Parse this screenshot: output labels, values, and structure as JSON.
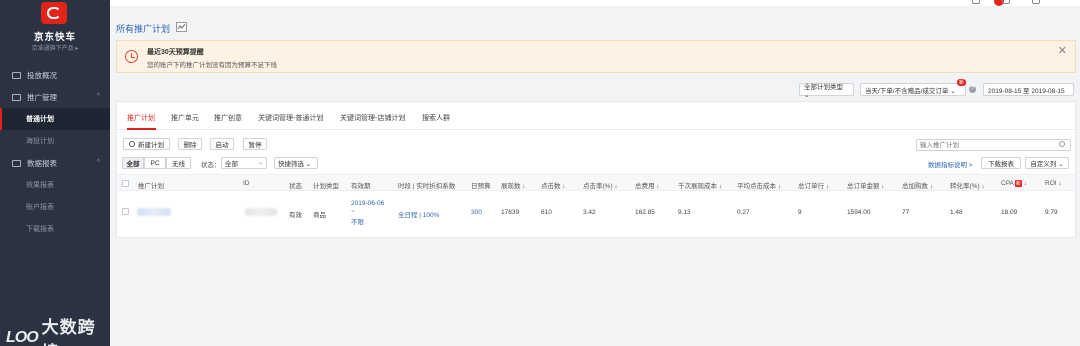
{
  "sidebar": {
    "brand": "京东快车",
    "brand_sub": "京准通旗下产品 ▸",
    "items": [
      {
        "label": "投放概况"
      },
      {
        "label": "推广管理"
      },
      {
        "label": "数据报表"
      }
    ],
    "sub_promo": [
      {
        "label": "普通计划"
      },
      {
        "label": "海投计划"
      }
    ],
    "sub_report": [
      {
        "label": "效果报表"
      },
      {
        "label": "账户报表"
      },
      {
        "label": "下载报表"
      }
    ]
  },
  "watermark": {
    "logo": "LOO",
    "text": "大数跨境"
  },
  "header": {
    "title": "所有推广计划"
  },
  "alert": {
    "title": "最近30天预算提醒",
    "text": "您的账户下的推广计划没有因为预算不足下线"
  },
  "filters": {
    "plan_type": "全部计划类型 ⌄",
    "attribution": "当天/下单/不含赠品/成交订单 ⌄",
    "new_badge": "新",
    "help": "?",
    "date_range": "2019-08-15 至 2019-08-15"
  },
  "tabs": [
    {
      "label": "推广计划"
    },
    {
      "label": "推广单元"
    },
    {
      "label": "推广创意"
    },
    {
      "label": "关键词管理-普通计划"
    },
    {
      "label": "关键词管理-店铺计划"
    },
    {
      "label": "搜索人群"
    }
  ],
  "toolbar": {
    "new_plan": "新建计划",
    "delete": "删除",
    "start": "启动",
    "pause": "暂停",
    "search_placeholder": "输入推广计划"
  },
  "segment": {
    "all": "全部",
    "pc": "PC",
    "wireless": "无线"
  },
  "status_filter": {
    "label": "状态：",
    "value": "全部",
    "quick_filter": "快捷筛选 ⌄"
  },
  "right_actions": {
    "metrics_desc": "数据指标说明 >",
    "download": "下载报表",
    "custom_columns": "自定义列 ⌄"
  },
  "table": {
    "headers": {
      "name": "推广计划",
      "id": "ID",
      "status": "状态",
      "plan_type": "计划类型",
      "valid": "有效期",
      "time": "时段 | 实时折扣系数",
      "budget": "日预算",
      "impressions": "展现数 ↓",
      "clicks": "点击数 ↓",
      "ctr": "点击率(%) ↓",
      "cost": "总费用 ↓",
      "cpm": "千次展现成本 ↓",
      "cpc": "平均点击成本 ↓",
      "orders": "总订单行 ↓",
      "order_amount": "总订单金额 ↓",
      "cart": "总加购数 ↓",
      "cvr": "转化率(%) ↓",
      "cpa": "CPA",
      "cpa_badge": "新",
      "cpa_arrow": "↓",
      "roi": "ROI ↓"
    },
    "rows": [
      {
        "status": "有效",
        "plan_type": "商品",
        "valid_start": "2019-06-06",
        "valid_sep": "~",
        "valid_end": "不限",
        "time": "全日程 | 100%",
        "budget": "300",
        "impressions": "17839",
        "clicks": "610",
        "ctr": "3.42",
        "cost": "162.85",
        "cpm": "9.13",
        "cpc": "0.27",
        "orders": "9",
        "order_amount": "1594.00",
        "cart": "77",
        "cvr": "1.48",
        "cpa": "18.09",
        "roi": "9.79"
      }
    ]
  },
  "colors": {
    "sidebar_bg": "#2b3343",
    "accent": "#e2231a",
    "link": "#2f66b3",
    "alert_bg": "#fdf2e4"
  }
}
